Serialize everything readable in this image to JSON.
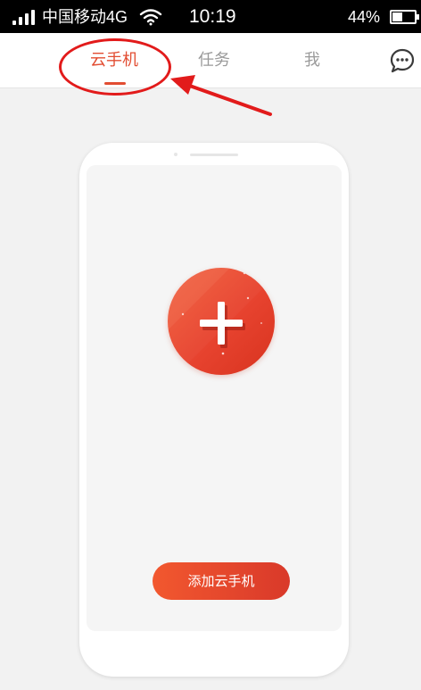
{
  "status_bar": {
    "carrier": "中国移动4G",
    "time": "10:19",
    "battery_percent": "44%",
    "battery_level": 0.44,
    "icons": [
      "signal-icon",
      "wifi-icon",
      "battery-icon"
    ]
  },
  "nav": {
    "tabs": [
      {
        "label": "云手机",
        "active": true
      },
      {
        "label": "任务",
        "active": false
      },
      {
        "label": "我",
        "active": false
      }
    ],
    "right_icon": "chat-bubble-icon"
  },
  "phone_card": {
    "add_icon": "plus-icon",
    "add_button_label": "添加云手机"
  },
  "colors": {
    "accent": "#e24d32",
    "status_bar_bg": "#000000",
    "page_bg": "#f2f2f2",
    "annotation": "#e21b1b"
  }
}
